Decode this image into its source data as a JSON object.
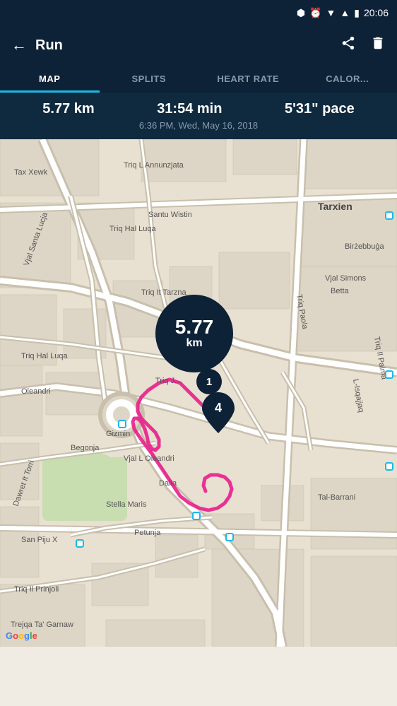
{
  "statusBar": {
    "time": "20:06",
    "icons": [
      "bluetooth",
      "alarm",
      "wifi",
      "signal",
      "battery"
    ]
  },
  "header": {
    "title": "Run",
    "backLabel": "←",
    "shareLabel": "⬆",
    "deleteLabel": "🗑"
  },
  "tabs": [
    {
      "id": "map",
      "label": "MAP",
      "active": true
    },
    {
      "id": "splits",
      "label": "SPLITS",
      "active": false
    },
    {
      "id": "heartrate",
      "label": "HEART RATE",
      "active": false
    },
    {
      "id": "calories",
      "label": "CALOR...",
      "active": false
    }
  ],
  "stats": {
    "distance": "5.77 km",
    "duration": "31:54 min",
    "pace": "5'31\" pace",
    "datetime": "6:36 PM, Wed, May 16, 2018"
  },
  "map": {
    "distanceBubble": {
      "value": "5.77",
      "unit": "km"
    },
    "markers": [
      {
        "id": "1",
        "label": "1"
      },
      {
        "id": "4",
        "label": "4"
      }
    ],
    "googleLogo": "Google"
  }
}
